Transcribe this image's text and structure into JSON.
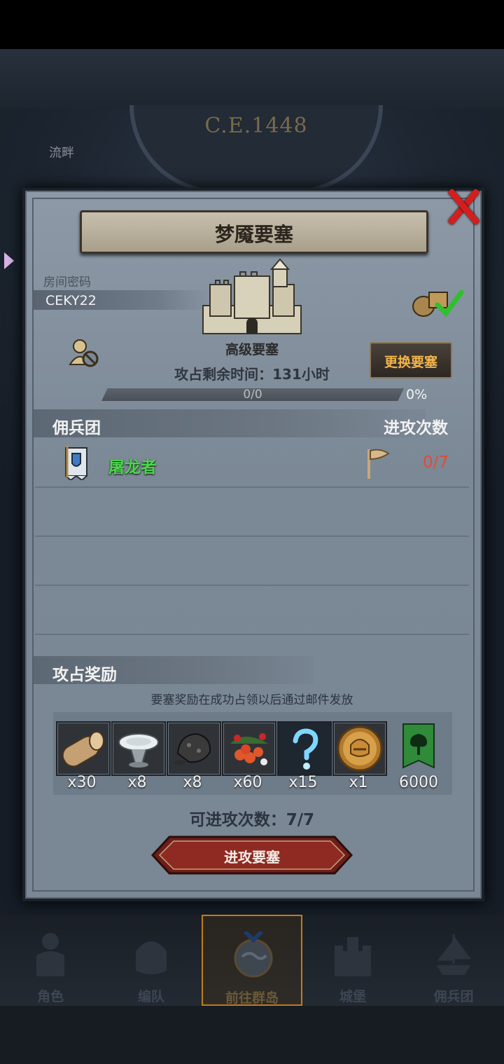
{
  "background": {
    "era": "C.E.1448",
    "tag": "流畔"
  },
  "modal": {
    "title": "梦魇要塞",
    "room_label": "房间密码",
    "room_code": "CEKY22",
    "fortress_name": "高级要塞",
    "change_button": "更换要塞",
    "time_remaining": "攻占剩余时间：131小时",
    "progress": {
      "text": "0/0",
      "percent_label": "0%",
      "fraction": 0.0
    },
    "mercenary_header": "佣兵团",
    "attacks_header": "进攻次数",
    "mercenaries": [
      {
        "name": "屠龙者",
        "attacks": "0/7"
      }
    ],
    "rewards_header": "攻占奖励",
    "rewards_note": "要塞奖励在成功占领以后通过邮件发放",
    "rewards": [
      {
        "icon": "wood-log-icon",
        "count": "x30"
      },
      {
        "icon": "silver-bowl-icon",
        "count": "x8"
      },
      {
        "icon": "ore-stone-icon",
        "count": "x8"
      },
      {
        "icon": "berries-icon",
        "count": "x60"
      },
      {
        "icon": "magic-question-icon",
        "count": "x15"
      },
      {
        "icon": "knight-helmet-coin-icon",
        "count": "x1"
      },
      {
        "icon": "green-tree-banner-icon",
        "count": "6000"
      }
    ],
    "attacks_available": "可进攻次数：7/7",
    "attack_button": "进攻要塞"
  },
  "nav": [
    {
      "label": "角色",
      "icon": "knight-icon"
    },
    {
      "label": "编队",
      "icon": "helmet-icon"
    },
    {
      "label": "前往群岛",
      "icon": "globe-icon"
    },
    {
      "label": "城堡",
      "icon": "castle-icon"
    },
    {
      "label": "佣兵团",
      "icon": "ship-icon"
    }
  ],
  "colors": {
    "accent": "#f2b54a",
    "green_name": "#4cd64c",
    "red_count": "#e34a3a",
    "close": "#d41e1e"
  }
}
